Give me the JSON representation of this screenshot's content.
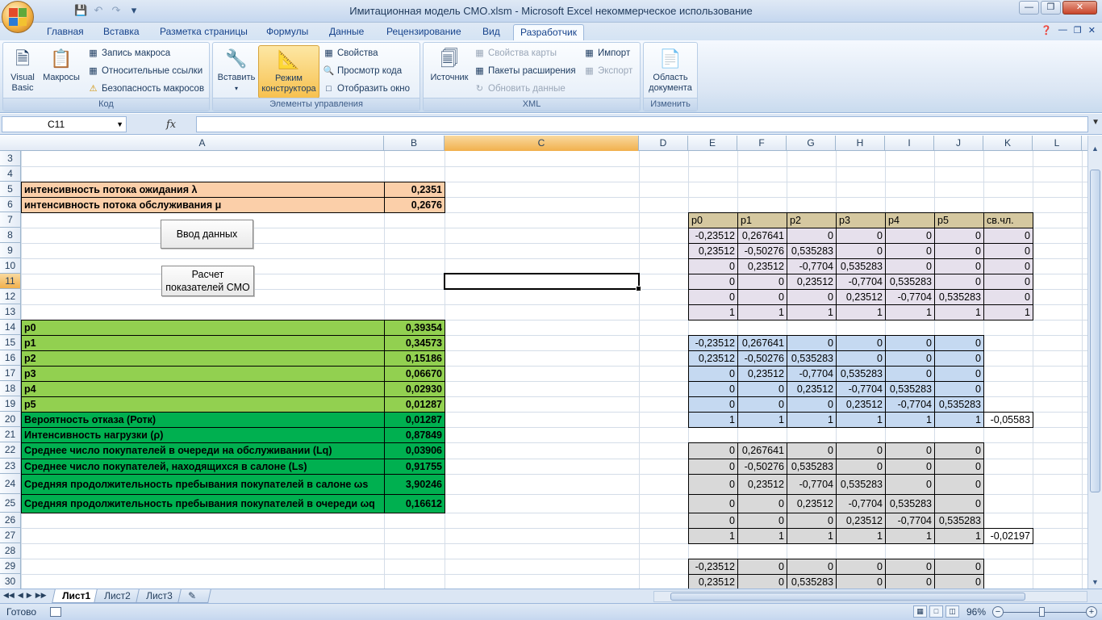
{
  "window": {
    "title": "Имитационная модель СМО.xlsm - Microsoft Excel некоммерческое использование"
  },
  "qat": {
    "save_icon": "save-icon",
    "undo_icon": "undo-icon",
    "redo_icon": "redo-icon"
  },
  "tabs": [
    "Главная",
    "Вставка",
    "Разметка страницы",
    "Формулы",
    "Данные",
    "Рецензирование",
    "Вид",
    "Разработчик"
  ],
  "active_tab": "Разработчик",
  "ribbon": {
    "code": {
      "label": "Код",
      "visual_basic": "Visual Basic",
      "macros": "Макросы",
      "record_macro": "Запись макроса",
      "relative_refs": "Относительные ссылки",
      "macro_security": "Безопасность макросов"
    },
    "controls": {
      "label": "Элементы управления",
      "insert": "Вставить",
      "design_mode": "Режим конструктора",
      "properties": "Свойства",
      "view_code": "Просмотр кода",
      "run_dialog": "Отобразить окно"
    },
    "xml": {
      "label": "XML",
      "source": "Источник",
      "map_properties": "Свойства карты",
      "expansion_packs": "Пакеты расширения",
      "refresh_data": "Обновить данные",
      "import": "Импорт",
      "export": "Экспорт"
    },
    "modify": {
      "label": "Изменить",
      "doc_panel": "Область документа"
    }
  },
  "formula_bar": {
    "name_box": "C11",
    "fx": "fx",
    "formula": ""
  },
  "columns": [
    "A",
    "B",
    "C",
    "D",
    "E",
    "F",
    "G",
    "H",
    "I",
    "J",
    "K",
    "L"
  ],
  "selected_column": "C",
  "rows": [
    "3",
    "4",
    "5",
    "6",
    "7",
    "8",
    "9",
    "10",
    "11",
    "12",
    "13",
    "14",
    "15",
    "16",
    "17",
    "18",
    "19",
    "20",
    "21",
    "22",
    "23",
    "24",
    "25",
    "26",
    "27",
    "28",
    "29",
    "30"
  ],
  "selected_row": "11",
  "buttons": {
    "input": "Ввод данных",
    "calc": "Расчет показателей СМО"
  },
  "params": [
    {
      "label": "интенсивность потока ожидания λ",
      "value": "0,2351"
    },
    {
      "label": "интенсивность потока обслуживания μ",
      "value": "0,2676"
    }
  ],
  "results": [
    {
      "label": "p0",
      "value": "0,39354"
    },
    {
      "label": "p1",
      "value": "0,34573"
    },
    {
      "label": "p2",
      "value": "0,15186"
    },
    {
      "label": "p3",
      "value": "0,06670"
    },
    {
      "label": "p4",
      "value": "0,02930"
    },
    {
      "label": "p5",
      "value": "0,01287"
    },
    {
      "label": "Вероятность отказа (Ротк)",
      "value": "0,01287"
    },
    {
      "label": "Интенсивность нагрузки (ρ)",
      "value": "0,87849"
    },
    {
      "label": "Среднее число покупателей в очереди на обслуживании (Lq)",
      "value": "0,03906"
    },
    {
      "label": "Среднее число покупателей, находящихся в салоне (Ls)",
      "value": "0,91755"
    },
    {
      "label": "Средняя продолжительность пребывания покупателей в салоне ωs",
      "value": "3,90246"
    },
    {
      "label": "Средняя продолжительность пребывания покупателей в очереди ωq",
      "value": "0,16612"
    }
  ],
  "matrix_header": [
    "p0",
    "p1",
    "p2",
    "p3",
    "p4",
    "p5",
    "св.чл."
  ],
  "matrix1": [
    [
      "-0,23512",
      "0,267641",
      "0",
      "0",
      "0",
      "0",
      "0"
    ],
    [
      "0,23512",
      "-0,50276",
      "0,535283",
      "0",
      "0",
      "0",
      "0"
    ],
    [
      "0",
      "0,23512",
      "-0,7704",
      "0,535283",
      "0",
      "0",
      "0"
    ],
    [
      "0",
      "0",
      "0,23512",
      "-0,7704",
      "0,535283",
      "0",
      "0"
    ],
    [
      "0",
      "0",
      "0",
      "0,23512",
      "-0,7704",
      "0,535283",
      "0"
    ],
    [
      "1",
      "1",
      "1",
      "1",
      "1",
      "1",
      "1"
    ]
  ],
  "matrix2": [
    [
      "-0,23512",
      "0,267641",
      "0",
      "0",
      "0",
      "0",
      ""
    ],
    [
      "0,23512",
      "-0,50276",
      "0,535283",
      "0",
      "0",
      "0",
      ""
    ],
    [
      "0",
      "0,23512",
      "-0,7704",
      "0,535283",
      "0",
      "0",
      ""
    ],
    [
      "0",
      "0",
      "0,23512",
      "-0,7704",
      "0,535283",
      "0",
      ""
    ],
    [
      "0",
      "0",
      "0",
      "0,23512",
      "-0,7704",
      "0,535283",
      ""
    ],
    [
      "1",
      "1",
      "1",
      "1",
      "1",
      "1",
      "-0,05583"
    ]
  ],
  "matrix3": [
    [
      "0",
      "0,267641",
      "0",
      "0",
      "0",
      "0",
      ""
    ],
    [
      "0",
      "-0,50276",
      "0,535283",
      "0",
      "0",
      "0",
      ""
    ],
    [
      "0",
      "0,23512",
      "-0,7704",
      "0,535283",
      "0",
      "0",
      ""
    ],
    [
      "0",
      "0",
      "0,23512",
      "-0,7704",
      "0,535283",
      "0",
      ""
    ],
    [
      "0",
      "0",
      "0",
      "0,23512",
      "-0,7704",
      "0,535283",
      ""
    ],
    [
      "1",
      "1",
      "1",
      "1",
      "1",
      "1",
      "-0,02197"
    ]
  ],
  "matrix4": [
    [
      "-0,23512",
      "0",
      "0",
      "0",
      "0",
      "0",
      ""
    ],
    [
      "0,23512",
      "0",
      "0,535283",
      "0",
      "0",
      "0",
      ""
    ]
  ],
  "colors": {
    "param_fill": "#fbcfa9",
    "prob_fill": "#92d050",
    "metric_fill": "#00b050",
    "matrix_header_fill": "#d5c8a0",
    "matrix1_fill": "#e6e0ec",
    "matrix2_fill": "#c5d9f1",
    "matrix3_fill": "#d9d9d9"
  },
  "sheets": [
    "Лист1",
    "Лист2",
    "Лист3"
  ],
  "active_sheet": "Лист1",
  "status": {
    "ready": "Готово",
    "zoom": "96%"
  }
}
